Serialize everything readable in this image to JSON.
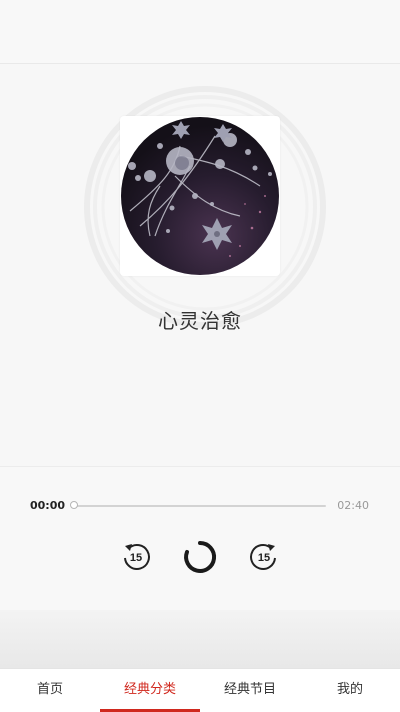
{
  "album": {
    "title": "心灵治愈",
    "cover_icon": "flower-artwork"
  },
  "player": {
    "current_time": "00:00",
    "total_time": "02:40",
    "progress": 0,
    "rewind_seconds": "15",
    "forward_seconds": "15",
    "state": "loading"
  },
  "tabs": [
    {
      "label": "首页",
      "active": false
    },
    {
      "label": "经典分类",
      "active": true
    },
    {
      "label": "经典节目",
      "active": false
    },
    {
      "label": "我的",
      "active": false
    }
  ],
  "colors": {
    "accent": "#d0281e",
    "cover_dark": "#1c1624",
    "cover_purple": "#4a3350"
  }
}
